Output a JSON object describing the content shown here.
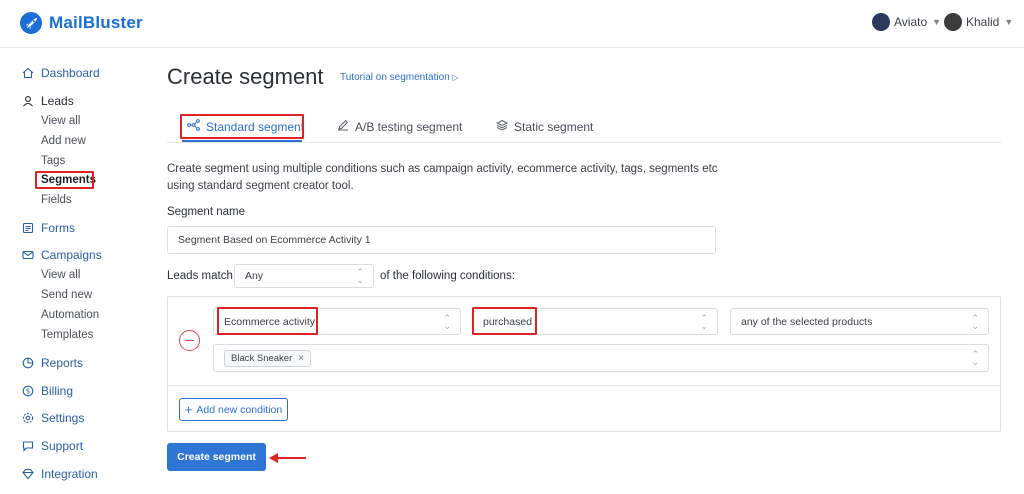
{
  "header": {
    "brand": "MailBluster",
    "accounts": [
      {
        "name": "Aviato"
      },
      {
        "name": "Khalid"
      }
    ]
  },
  "sidebar": {
    "dashboard": "Dashboard",
    "leads": {
      "label": "Leads",
      "items": [
        "View all",
        "Add new",
        "Tags",
        "Segments",
        "Fields"
      ],
      "active": "Segments"
    },
    "forms": "Forms",
    "campaigns": {
      "label": "Campaigns",
      "items": [
        "View all",
        "Send new",
        "Automation",
        "Templates"
      ]
    },
    "reports": "Reports",
    "billing": "Billing",
    "settings": "Settings",
    "support": "Support",
    "integration": "Integration"
  },
  "main": {
    "title": "Create segment",
    "tutorial_link": "Tutorial on segmentation",
    "tabs": [
      {
        "label": "Standard segment",
        "active": true
      },
      {
        "label": "A/B testing segment",
        "active": false
      },
      {
        "label": "Static segment",
        "active": false
      }
    ],
    "description": "Create segment using multiple conditions such as campaign activity, ecommerce activity, tags, segments etc using standard segment creator tool.",
    "segment_name_label": "Segment name",
    "segment_name_value": "Segment Based on Ecommerce Activity 1",
    "leads_match_label": "Leads match",
    "leads_match_value": "Any",
    "conditions_suffix": "of the following conditions:",
    "condition": {
      "field": "Ecommerce activity",
      "operator": "purchased",
      "scope": "any of the selected products",
      "tags": [
        "Black Sneaker"
      ]
    },
    "add_condition_label": "Add new condition",
    "create_button_label": "Create segment"
  },
  "colors": {
    "brand": "#1a6fd4",
    "accent": "#2f75d6",
    "highlight": "#e02424"
  }
}
